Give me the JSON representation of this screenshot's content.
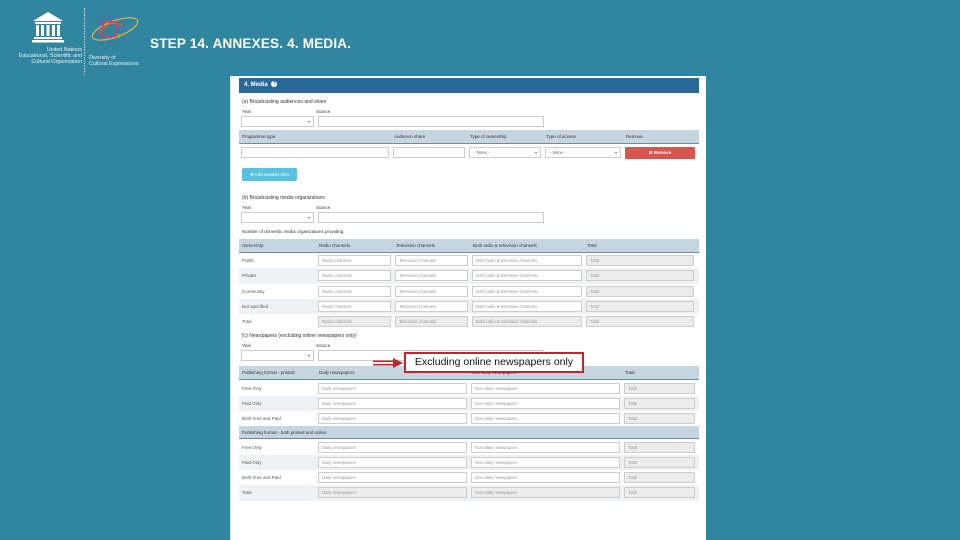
{
  "header": {
    "title": "STEP 14. ANNEXES. 4. MEDIA.",
    "unesco_logo_icon": "unesco-temple-icon",
    "unesco_text": [
      "United Nations",
      "Educational, Scientific and",
      "Cultural Organization"
    ],
    "convention_logo_icon": "diversity-globe-icon",
    "convention_text": [
      "Diversity of",
      "Cultural Expressions"
    ]
  },
  "form": {
    "section_title": "4. Media",
    "help_icon": "question-circle-icon",
    "part_a": {
      "title": "(a) Broadcasting audiences and share",
      "year_label": "Year",
      "source_label": "Source",
      "columns": [
        "Programme type",
        "Audience share",
        "Type of ownership",
        "Type of access",
        "Remove"
      ],
      "row": {
        "ownership_value": "- None -",
        "access_value": "- None -",
        "remove_label": "✖ Remove"
      },
      "add_button": "✚ Add another item"
    },
    "part_b": {
      "title": "(b) Broadcasting media organizations",
      "year_label": "Year",
      "source_label": "Source",
      "table_caption": "Number of domestic media organizations providing:",
      "columns": [
        "Ownership",
        "Radio channels",
        "Television channels",
        "Both radio & television channels",
        "Total"
      ],
      "placeholders": [
        "Radio channels",
        "Television channels",
        "Both radio & television channels",
        "Total"
      ],
      "rows": [
        "Public",
        "Private",
        "Community",
        "Not specified",
        "Total"
      ]
    },
    "part_c": {
      "title": "(c) Newspapers (excluding online newspapers only)",
      "year_label": "Year",
      "source_label": "Source",
      "columns": [
        "Publishing format - printed",
        "Daily newspapers",
        "Non-daily newspapers",
        "Total"
      ],
      "placeholders": [
        "Daily newspapers",
        "Non-daily newspapers",
        "Total"
      ],
      "rows_printed": [
        "Free Only",
        "Paid Only",
        "Both Free and Paid"
      ],
      "group2_title": "Publishing format - both printed and online",
      "rows_both": [
        "Free Only",
        "Paid Only",
        "Both Free and Paid",
        "Total"
      ]
    }
  },
  "annotation": {
    "text": "Excluding online newspapers only",
    "arrow_icon": "right-arrow-icon",
    "color": "#c0262d"
  },
  "colors": {
    "background": "#31869f",
    "section_header": "#2a6898",
    "table_header": "#c5d6e1",
    "remove_button": "#d9534f",
    "add_button": "#5bc0de"
  }
}
